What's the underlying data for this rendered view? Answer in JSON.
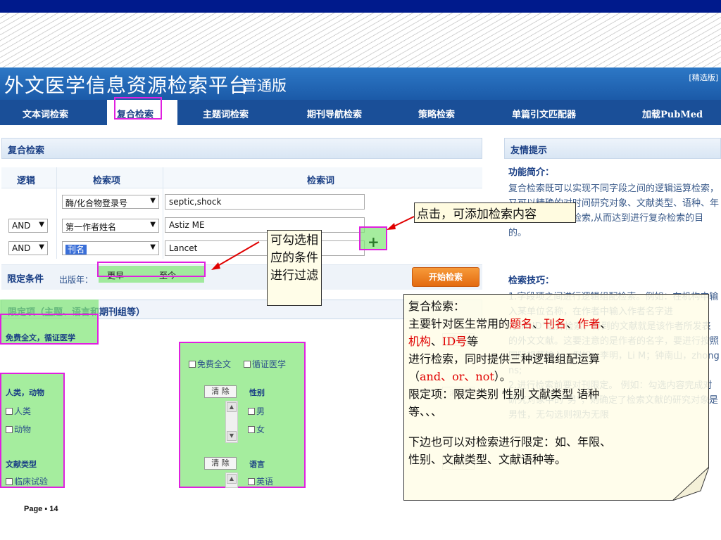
{
  "site": {
    "title": "外文医学信息资源检索平台",
    "edition": "普通版",
    "alt_edition": "[精选版]"
  },
  "nav": {
    "tabs": [
      {
        "label": "文本词检索"
      },
      {
        "label": "复合检索"
      },
      {
        "label": "主题词检索"
      },
      {
        "label": "期刊导航检索"
      },
      {
        "label": "策略检索"
      },
      {
        "label": "单篇引文匹配器"
      },
      {
        "label": "加载PubMed"
      }
    ]
  },
  "form": {
    "panel_title": "复合检索",
    "col_logic": "逻辑",
    "col_field": "检索项",
    "col_term": "检索词",
    "rows": [
      {
        "logic": "",
        "field": "酶/化合物登录号",
        "term": "septic,shock"
      },
      {
        "logic": "AND",
        "field": "第一作者姓名",
        "term": "Astiz ME"
      },
      {
        "logic": "AND",
        "field": "刊名",
        "term": "Lancet"
      }
    ],
    "limit_label": "限定条件",
    "pub_year_label": "出版年：",
    "year_from": "更早",
    "year_to": "至今",
    "search_button": "开始检索"
  },
  "limits": {
    "title": "限定项（主题、语言和期刊组等）",
    "free_full": "免费全文，循证医学",
    "opt_free": "免费全文",
    "opt_ebm": "循证医学",
    "clear": "清 除",
    "subject_title": "人类，动物",
    "subject_opts": [
      "人类",
      "动物"
    ],
    "sex_title": "性别",
    "sex_opts": [
      "男",
      "女"
    ],
    "doctype_title": "文献类型",
    "doctype_opts": [
      "临床试验"
    ],
    "lang_title": "语言",
    "lang_opts": [
      "英语"
    ]
  },
  "tips": {
    "panel_title": "友情提示",
    "func_title": "功能简介：",
    "func_text": "复合检索既可以实现不同字段之间的逻辑运算检索，又可以精确的对时间研究对象、文献类型、语种、年龄组等进行限定检索,从而达到进行复杂检索的目的。",
    "skill_title": "检索技巧：",
    "skill_text": "1.字段项之间进行逻辑组配检索。例如：在机构中输入某单位名称，在作者中输入作者名字进行\"AND\"运算检索，得到的文献就是该作者所发表的外文文献。这要注意的是作者的名字，要进行按照国际规范输入。例如：李明，Li M；钟南山，zhong ns;\n2.进行检索前要对刊限定。 例如：勾选内容完成对研究对象中的\"男\"，则确定了检索文献的研究对象是男性，无勾选则视为无限"
  },
  "annotations": {
    "add_hint": "点击，可添加检索内容",
    "filter_hint": "可勾选相应的条件进行过滤",
    "note_lines": {
      "l1": "复合检索：",
      "l2a": "主要针对医生常用的",
      "l2b": "题名",
      "l2c": "、",
      "l2d": "刊名",
      "l2e": "、",
      "l2f": "作者",
      "l2g": "、",
      "l3a": "机构",
      "l3b": "、",
      "l3c": "ID号",
      "l3d": "等",
      "l4": "进行检索，同时提供三种逻辑组配运算",
      "l5a": "（",
      "l5b": "and、or、not",
      "l5c": "）。",
      "l6": "限定项：限定类别 性别 文献类型 语种",
      "l7": "等、、、",
      "l8": "下边也可以对检索进行限定：如、年限、",
      "l9": "性别、文献类型、文献语种等。"
    }
  },
  "footer": {
    "page": "Page ▪ 14"
  }
}
